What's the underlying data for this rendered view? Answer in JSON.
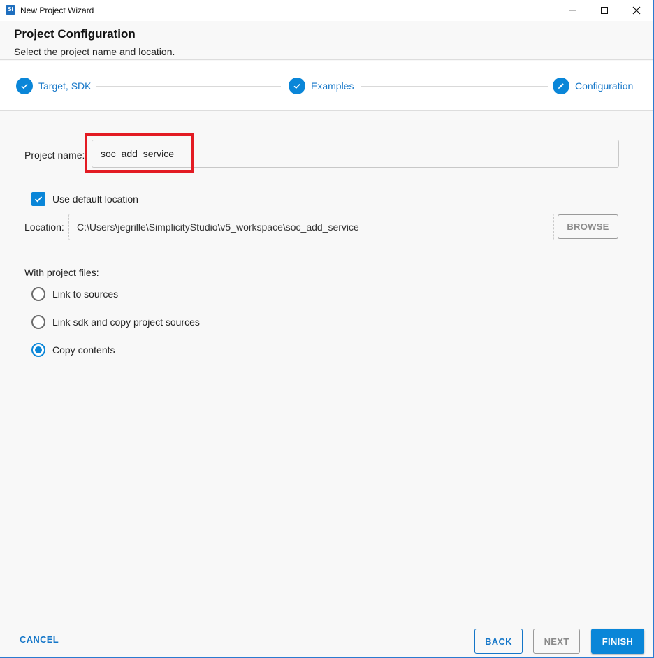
{
  "window": {
    "title": "New Project Wizard",
    "app_icon_text": "Si",
    "controls": [
      "minimize-icon",
      "maximize-icon",
      "close-icon"
    ]
  },
  "header": {
    "title": "Project Configuration",
    "subtitle": "Select the project name and location."
  },
  "stepper": {
    "steps": [
      {
        "label": "Target, SDK",
        "state": "completed",
        "icon": "check-icon"
      },
      {
        "label": "Examples",
        "state": "completed",
        "icon": "check-icon"
      },
      {
        "label": "Configuration",
        "state": "active",
        "icon": "pencil-icon"
      }
    ]
  },
  "form": {
    "project_name_label": "Project name:",
    "project_name_value": "soc_add_service",
    "use_default_location_label": "Use default location",
    "use_default_location_checked": true,
    "location_label": "Location:",
    "location_value": "C:\\Users\\jegrille\\SimplicityStudio\\v5_workspace\\soc_add_service",
    "browse_label": "BROWSE",
    "project_files_label": "With project files:",
    "project_files_options": [
      {
        "label": "Link to sources",
        "checked": false
      },
      {
        "label": "Link sdk and copy project sources",
        "checked": false
      },
      {
        "label": "Copy contents",
        "checked": true
      }
    ]
  },
  "footer": {
    "cancel_label": "CANCEL",
    "back_label": "BACK",
    "next_label": "NEXT",
    "finish_label": "FINISH"
  },
  "colors": {
    "accent": "#0a86d8",
    "highlight_box": "#e31b23",
    "link_text": "#1476c8",
    "disabled_text": "#8a8a8a"
  }
}
